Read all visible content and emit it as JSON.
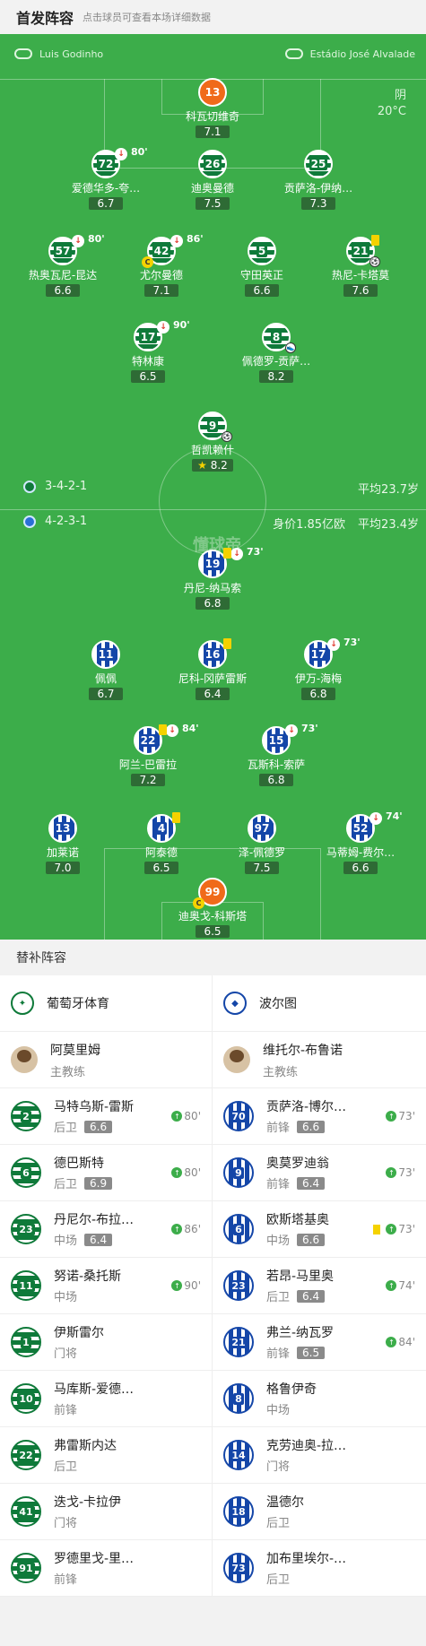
{
  "header": {
    "title": "首发阵容",
    "subtitle": "点击球员可查看本场详细数据"
  },
  "match": {
    "referee": "Luis Godinho",
    "stadium": "Estádio José Alvalade",
    "weather": "阴",
    "temperature": "20°C",
    "watermark": "懂球帝"
  },
  "home_formation": {
    "formation": "3-4-2-1",
    "avg_age": "平均23.7岁"
  },
  "away_formation": {
    "formation": "4-2-3-1",
    "value": "身价1.85亿欧",
    "avg_age": "平均23.4岁"
  },
  "home_players": [
    {
      "num": "13",
      "name": "科瓦切维奇",
      "rating": "7.1",
      "kit": "gk1"
    },
    {
      "num": "72",
      "name": "爱德华多-夸…",
      "rating": "6.7",
      "kit": "sp",
      "sub": "80'"
    },
    {
      "num": "26",
      "name": "迪奥曼德",
      "rating": "7.5",
      "kit": "sp"
    },
    {
      "num": "25",
      "name": "贡萨洛-伊纳…",
      "rating": "7.3",
      "kit": "sp"
    },
    {
      "num": "57",
      "name": "热奥瓦尼-昆达",
      "rating": "6.6",
      "kit": "sp",
      "sub": "80'"
    },
    {
      "num": "42",
      "name": "尤尔曼德",
      "rating": "7.1",
      "kit": "sp",
      "sub": "86'",
      "captain": true
    },
    {
      "num": "5",
      "name": "守田英正",
      "rating": "6.6",
      "kit": "sp"
    },
    {
      "num": "21",
      "name": "热尼-卡塔莫",
      "rating": "7.6",
      "kit": "sp",
      "yellow": true,
      "goal": true
    },
    {
      "num": "17",
      "name": "特林康",
      "rating": "6.5",
      "kit": "sp",
      "sub": "90'"
    },
    {
      "num": "8",
      "name": "佩德罗-贡萨…",
      "rating": "8.2",
      "kit": "sp",
      "assist": true
    },
    {
      "num": "9",
      "name": "哲凯赖什",
      "rating": "8.2",
      "kit": "sp",
      "goal": true,
      "best": true
    }
  ],
  "away_players": [
    {
      "num": "19",
      "name": "丹尼-纳马索",
      "rating": "6.8",
      "kit": "po",
      "yellow": true,
      "sub": "73'"
    },
    {
      "num": "11",
      "name": "佩佩",
      "rating": "6.7",
      "kit": "po"
    },
    {
      "num": "16",
      "name": "尼科-冈萨雷斯",
      "rating": "6.4",
      "kit": "po",
      "yellow": true
    },
    {
      "num": "17",
      "name": "伊万-海梅",
      "rating": "6.8",
      "kit": "po",
      "sub": "73'"
    },
    {
      "num": "22",
      "name": "阿兰-巴雷拉",
      "rating": "7.2",
      "kit": "po",
      "yellow": true,
      "sub": "84'"
    },
    {
      "num": "15",
      "name": "瓦斯科-索萨",
      "rating": "6.8",
      "kit": "po",
      "sub": "73'"
    },
    {
      "num": "13",
      "name": "加莱诺",
      "rating": "7.0",
      "kit": "po"
    },
    {
      "num": "4",
      "name": "阿泰德",
      "rating": "6.5",
      "kit": "po",
      "yellow": true
    },
    {
      "num": "97",
      "name": "泽-佩德罗",
      "rating": "7.5",
      "kit": "po"
    },
    {
      "num": "52",
      "name": "马蒂姆-费尔…",
      "rating": "6.6",
      "kit": "po",
      "sub": "74'"
    },
    {
      "num": "99",
      "name": "迪奥戈-科斯塔",
      "rating": "6.5",
      "kit": "gk2",
      "captain": true
    }
  ],
  "subs": {
    "title": "替补阵容",
    "home_team": "葡萄牙体育",
    "away_team": "波尔图",
    "home_coach": {
      "name": "阿莫里姆",
      "role": "主教练"
    },
    "away_coach": {
      "name": "维托尔-布鲁诺",
      "role": "主教练"
    },
    "home": [
      {
        "num": "2",
        "name": "马特乌斯-雷斯",
        "pos": "后卫",
        "rating": "6.6",
        "min": "80'"
      },
      {
        "num": "6",
        "name": "德巴斯特",
        "pos": "后卫",
        "rating": "6.9",
        "min": "80'"
      },
      {
        "num": "23",
        "name": "丹尼尔-布拉…",
        "pos": "中场",
        "rating": "6.4",
        "min": "86'"
      },
      {
        "num": "11",
        "name": "努诺-桑托斯",
        "pos": "中场",
        "rating": "",
        "min": "90'"
      },
      {
        "num": "1",
        "name": "伊斯雷尔",
        "pos": "门将",
        "rating": "",
        "min": ""
      },
      {
        "num": "10",
        "name": "马库斯-爱德…",
        "pos": "前锋",
        "rating": "",
        "min": ""
      },
      {
        "num": "22",
        "name": "弗雷斯内达",
        "pos": "后卫",
        "rating": "",
        "min": ""
      },
      {
        "num": "41",
        "name": "迭戈-卡拉伊",
        "pos": "门将",
        "rating": "",
        "min": ""
      },
      {
        "num": "91",
        "name": "罗德里戈-里…",
        "pos": "前锋",
        "rating": "",
        "min": ""
      }
    ],
    "away": [
      {
        "num": "70",
        "name": "贡萨洛-博尔…",
        "pos": "前锋",
        "rating": "6.6",
        "min": "73'"
      },
      {
        "num": "9",
        "name": "奥莫罗迪翁",
        "pos": "前锋",
        "rating": "6.4",
        "min": "73'"
      },
      {
        "num": "6",
        "name": "欧斯塔基奥",
        "pos": "中场",
        "rating": "6.6",
        "min": "73'",
        "yellow": true
      },
      {
        "num": "23",
        "name": "若昂-马里奥",
        "pos": "后卫",
        "rating": "6.4",
        "min": "74'"
      },
      {
        "num": "21",
        "name": "弗兰-纳瓦罗",
        "pos": "前锋",
        "rating": "6.5",
        "min": "84'"
      },
      {
        "num": "8",
        "name": "格鲁伊奇",
        "pos": "中场",
        "rating": "",
        "min": ""
      },
      {
        "num": "14",
        "name": "克劳迪奥-拉…",
        "pos": "门将",
        "rating": "",
        "min": ""
      },
      {
        "num": "18",
        "name": "温德尔",
        "pos": "后卫",
        "rating": "",
        "min": ""
      },
      {
        "num": "73",
        "name": "加布里埃尔-…",
        "pos": "后卫",
        "rating": "",
        "min": ""
      }
    ]
  }
}
